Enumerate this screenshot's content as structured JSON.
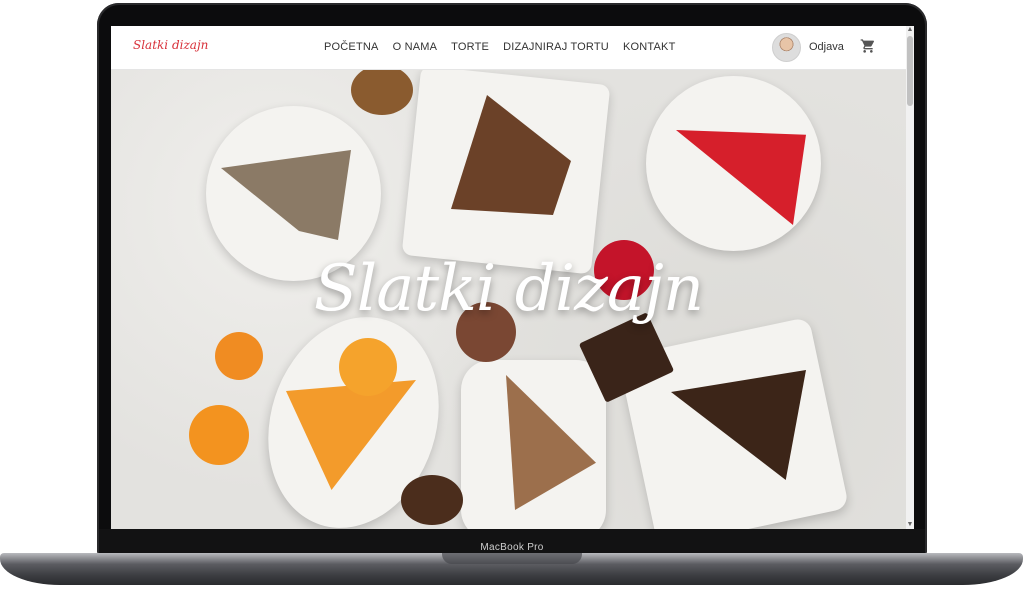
{
  "device": {
    "label": "MacBook Pro"
  },
  "navbar": {
    "logo": "Slatki dizajn",
    "links": [
      "POČETNA",
      "O NAMA",
      "TORTE",
      "DIZAJNIRAJ TORTU",
      "KONTAKT"
    ],
    "logout": "Odjava",
    "cart_icon": "shopping-cart-icon",
    "avatar_icon": "user-avatar"
  },
  "hero": {
    "title": "Slatki dizajn"
  },
  "colors": {
    "logo": "#d8313a",
    "nav_text": "#333333",
    "hero_title": "#ffffff"
  }
}
